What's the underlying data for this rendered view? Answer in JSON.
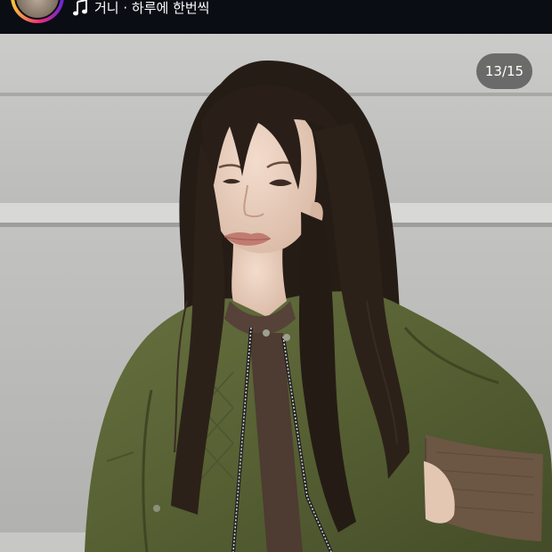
{
  "header": {
    "music_icon": "music-note-icon",
    "music_label": "거니 · 하루에 한번씩"
  },
  "media": {
    "counter": "13/15",
    "counter_current": 13,
    "counter_total": 15
  },
  "colors": {
    "top_bar": "#0b0d14",
    "story_ring_start": "#f9ce34",
    "story_ring_mid": "#ee2a7b",
    "story_ring_end": "#6228d7",
    "jacket": "#5a6234",
    "hair": "#231a14",
    "wall": "#c3c3c1"
  }
}
